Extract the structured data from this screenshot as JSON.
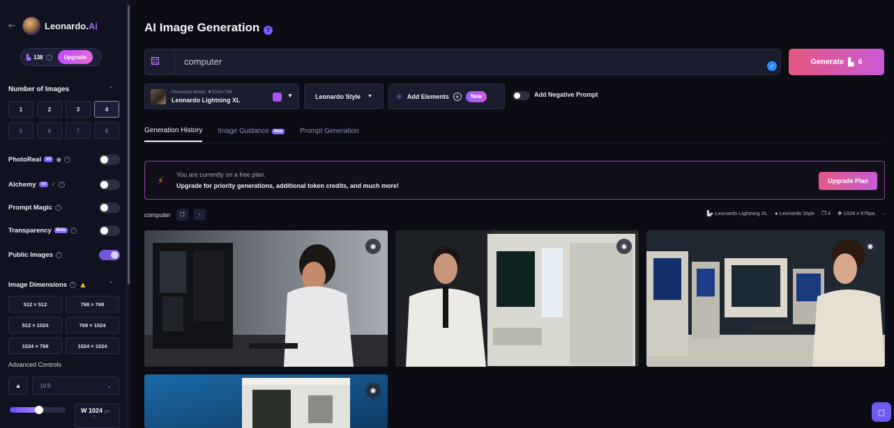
{
  "brand": {
    "name": "Leonardo.",
    "name_suffix": "Ai",
    "back_icon": "arrow-left-icon"
  },
  "tokens": {
    "count": "138",
    "upgrade_label": "Upgrade"
  },
  "number_of_images": {
    "title": "Number of Images",
    "options": [
      "1",
      "2",
      "3",
      "4",
      "5",
      "6",
      "7",
      "8"
    ],
    "selected": "4"
  },
  "toggles": [
    {
      "label": "PhotoReal",
      "badge": "V2",
      "state": "off"
    },
    {
      "label": "Alchemy",
      "badge": "V2",
      "state": "off"
    },
    {
      "label": "Prompt Magic",
      "state": "off"
    },
    {
      "label": "Transparency",
      "badge": "Beta",
      "state": "off"
    },
    {
      "label": "Public Images",
      "state": "on"
    }
  ],
  "dimensions": {
    "title": "Image Dimensions",
    "options": [
      "512 × 512",
      "768 × 768",
      "512 × 1024",
      "768 × 1024",
      "1024 × 768",
      "1024 × 1024"
    ]
  },
  "advanced": {
    "title": "Advanced Controls",
    "aspect_ratio": "16:9",
    "width_label": "W",
    "width_value": "1024",
    "width_unit": "px"
  },
  "header": {
    "title": "AI Image Generation",
    "help_icon": "question-icon"
  },
  "prompt": {
    "value": "computer",
    "generate_label": "Generate",
    "generate_cost": "6"
  },
  "model": {
    "sub_label": "Finetuned Model",
    "sub_size": "1024×768",
    "name": "Leonardo Lightning XL"
  },
  "style": {
    "label": "Leonardo Style"
  },
  "elements": {
    "label": "Add Elements",
    "new_badge": "New"
  },
  "negative_prompt": {
    "label": "Add Negative Prompt"
  },
  "tabs": [
    {
      "label": "Generation History",
      "active": true
    },
    {
      "label": "Image Guidance",
      "badge": "New"
    },
    {
      "label": "Prompt Generation"
    }
  ],
  "banner": {
    "line1": "You are currently on a free plan.",
    "line2": "Upgrade for priority generations, additional token credits, and much more!",
    "button": "Upgrade Plan"
  },
  "generation": {
    "prompt": "computer",
    "model": "Leonardo Lightning XL",
    "style": "Leonardo Style",
    "count": "4",
    "size": "1024 x 576px",
    "more": "···"
  },
  "colors": {
    "accent": "#7b5cff",
    "generate_gradient_start": "#e5577f",
    "generate_gradient_end": "#c95ad7"
  }
}
